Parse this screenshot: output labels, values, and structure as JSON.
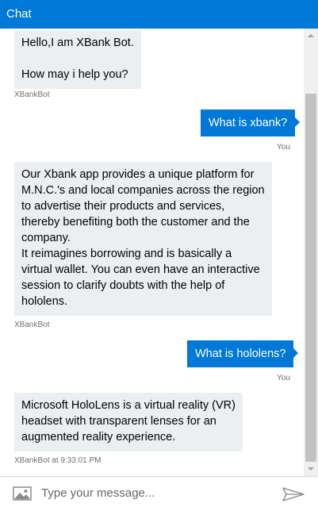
{
  "header": {
    "title": "Chat"
  },
  "messages": [
    {
      "from": "bot",
      "lines": [
        "Hello,I am XBank Bot.",
        "",
        "How may i help you?"
      ],
      "meta": "XBankBot"
    },
    {
      "from": "user",
      "text": "What is xbank?",
      "meta": "You"
    },
    {
      "from": "bot",
      "lines": [
        "Our Xbank app provides a unique platform for",
        "M.N.C.'s and local companies across the region",
        "to advertise their products and services,",
        "thereby benefiting both the customer and the",
        "company.",
        "It reimagines borrowing and is basically a",
        "virtual wallet. You can even have an interactive",
        "session to clarify doubts with the help of",
        "hololens."
      ],
      "meta": "XBankBot"
    },
    {
      "from": "user",
      "text": "What is hololens?",
      "meta": "You"
    },
    {
      "from": "bot",
      "lines": [
        "Microsoft HoloLens is a virtual reality (VR)",
        "headset with transparent lenses for an",
        "augmented reality experience."
      ],
      "meta": "XBankBot at 9:33:01 PM"
    }
  ],
  "input": {
    "placeholder": "Type your message..."
  },
  "icons": {
    "upload": "image-icon",
    "send": "send-icon"
  },
  "colors": {
    "accent": "#0078d7",
    "bot_bubble": "#eceff1"
  }
}
